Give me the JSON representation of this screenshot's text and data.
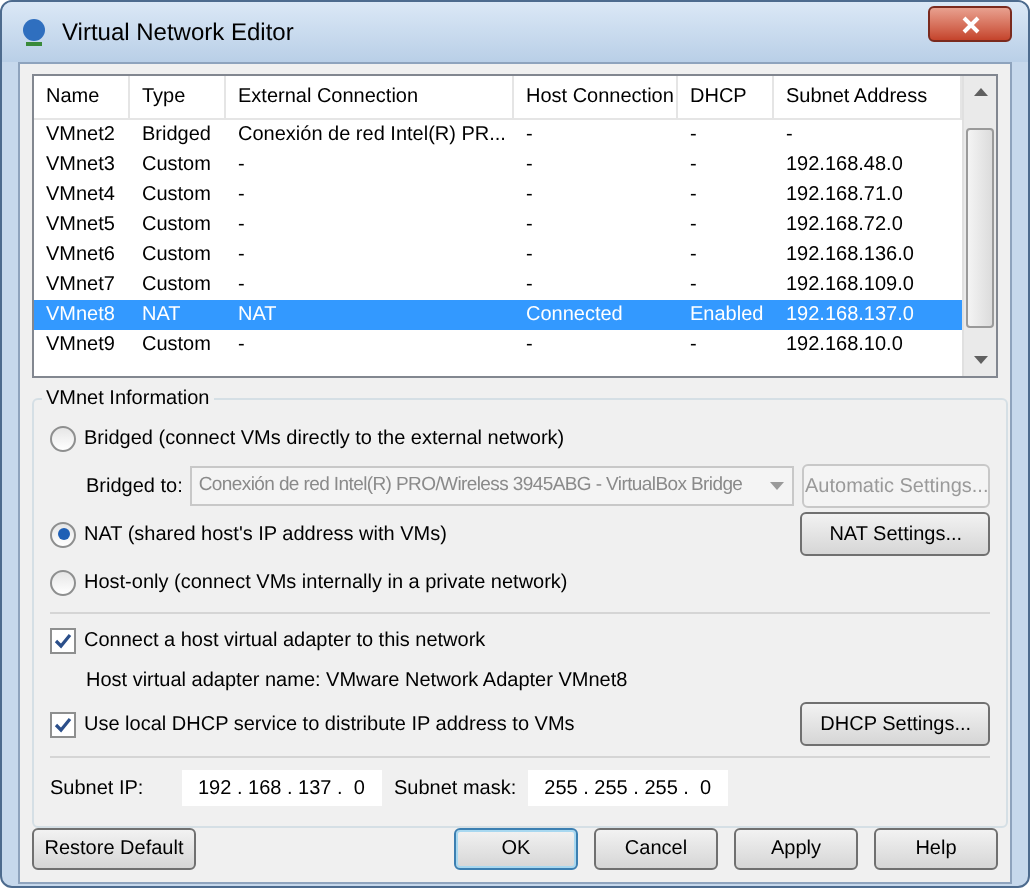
{
  "window": {
    "title": "Virtual Network Editor"
  },
  "table": {
    "columns": [
      "Name",
      "Type",
      "External Connection",
      "Host Connection",
      "DHCP",
      "Subnet Address"
    ],
    "rows": [
      {
        "cells": [
          "VMnet2",
          "Bridged",
          "Conexión de red Intel(R) PR...",
          "-",
          "-",
          "-"
        ],
        "selected": false
      },
      {
        "cells": [
          "VMnet3",
          "Custom",
          "-",
          "-",
          "-",
          "192.168.48.0"
        ],
        "selected": false
      },
      {
        "cells": [
          "VMnet4",
          "Custom",
          "-",
          "-",
          "-",
          "192.168.71.0"
        ],
        "selected": false
      },
      {
        "cells": [
          "VMnet5",
          "Custom",
          "-",
          "-",
          "-",
          "192.168.72.0"
        ],
        "selected": false
      },
      {
        "cells": [
          "VMnet6",
          "Custom",
          "-",
          "-",
          "-",
          "192.168.136.0"
        ],
        "selected": false
      },
      {
        "cells": [
          "VMnet7",
          "Custom",
          "-",
          "-",
          "-",
          "192.168.109.0"
        ],
        "selected": false
      },
      {
        "cells": [
          "VMnet8",
          "NAT",
          "NAT",
          "Connected",
          "Enabled",
          "192.168.137.0"
        ],
        "selected": true
      },
      {
        "cells": [
          "VMnet9",
          "Custom",
          "-",
          "-",
          "-",
          "192.168.10.0"
        ],
        "selected": false
      }
    ]
  },
  "vmnet_info": {
    "title": "VMnet Information",
    "options": [
      {
        "label": "Bridged (connect VMs directly to the external network)",
        "selected": false,
        "bridged_to": {
          "label": "Bridged to:",
          "value": "Conexión de red Intel(R) PRO/Wireless 3945ABG - VirtualBox Bridge",
          "disabled": true
        },
        "button": {
          "label": "Automatic Settings...",
          "disabled": true
        }
      },
      {
        "label": "NAT (shared host's IP address with VMs)",
        "selected": true,
        "button": {
          "label": "NAT Settings...",
          "disabled": false
        }
      },
      {
        "label": "Host-only (connect VMs internally in a private network)",
        "selected": false
      }
    ],
    "connect_adapter": {
      "label": "Connect a host virtual adapter to this network",
      "checked": true
    },
    "adapter_name": "Host virtual adapter name: VMware Network Adapter VMnet8",
    "dhcp": {
      "label": "Use local DHCP service to distribute IP address to VMs",
      "checked": true,
      "button": {
        "label": "DHCP Settings...",
        "disabled": false
      }
    },
    "subnet_ip": {
      "label": "Subnet IP:",
      "value": "192 . 168 . 137 .  0"
    },
    "subnet_mask": {
      "label": "Subnet mask:",
      "value": "255 . 255 . 255 .  0"
    }
  },
  "buttons": [
    {
      "label": "Restore Default",
      "kind": "left",
      "default": false
    },
    {
      "label": "OK",
      "kind": "right",
      "default": true
    },
    {
      "label": "Cancel",
      "kind": "right",
      "default": false
    },
    {
      "label": "Apply",
      "kind": "right",
      "default": false
    },
    {
      "label": "Help",
      "kind": "right",
      "default": false
    }
  ]
}
